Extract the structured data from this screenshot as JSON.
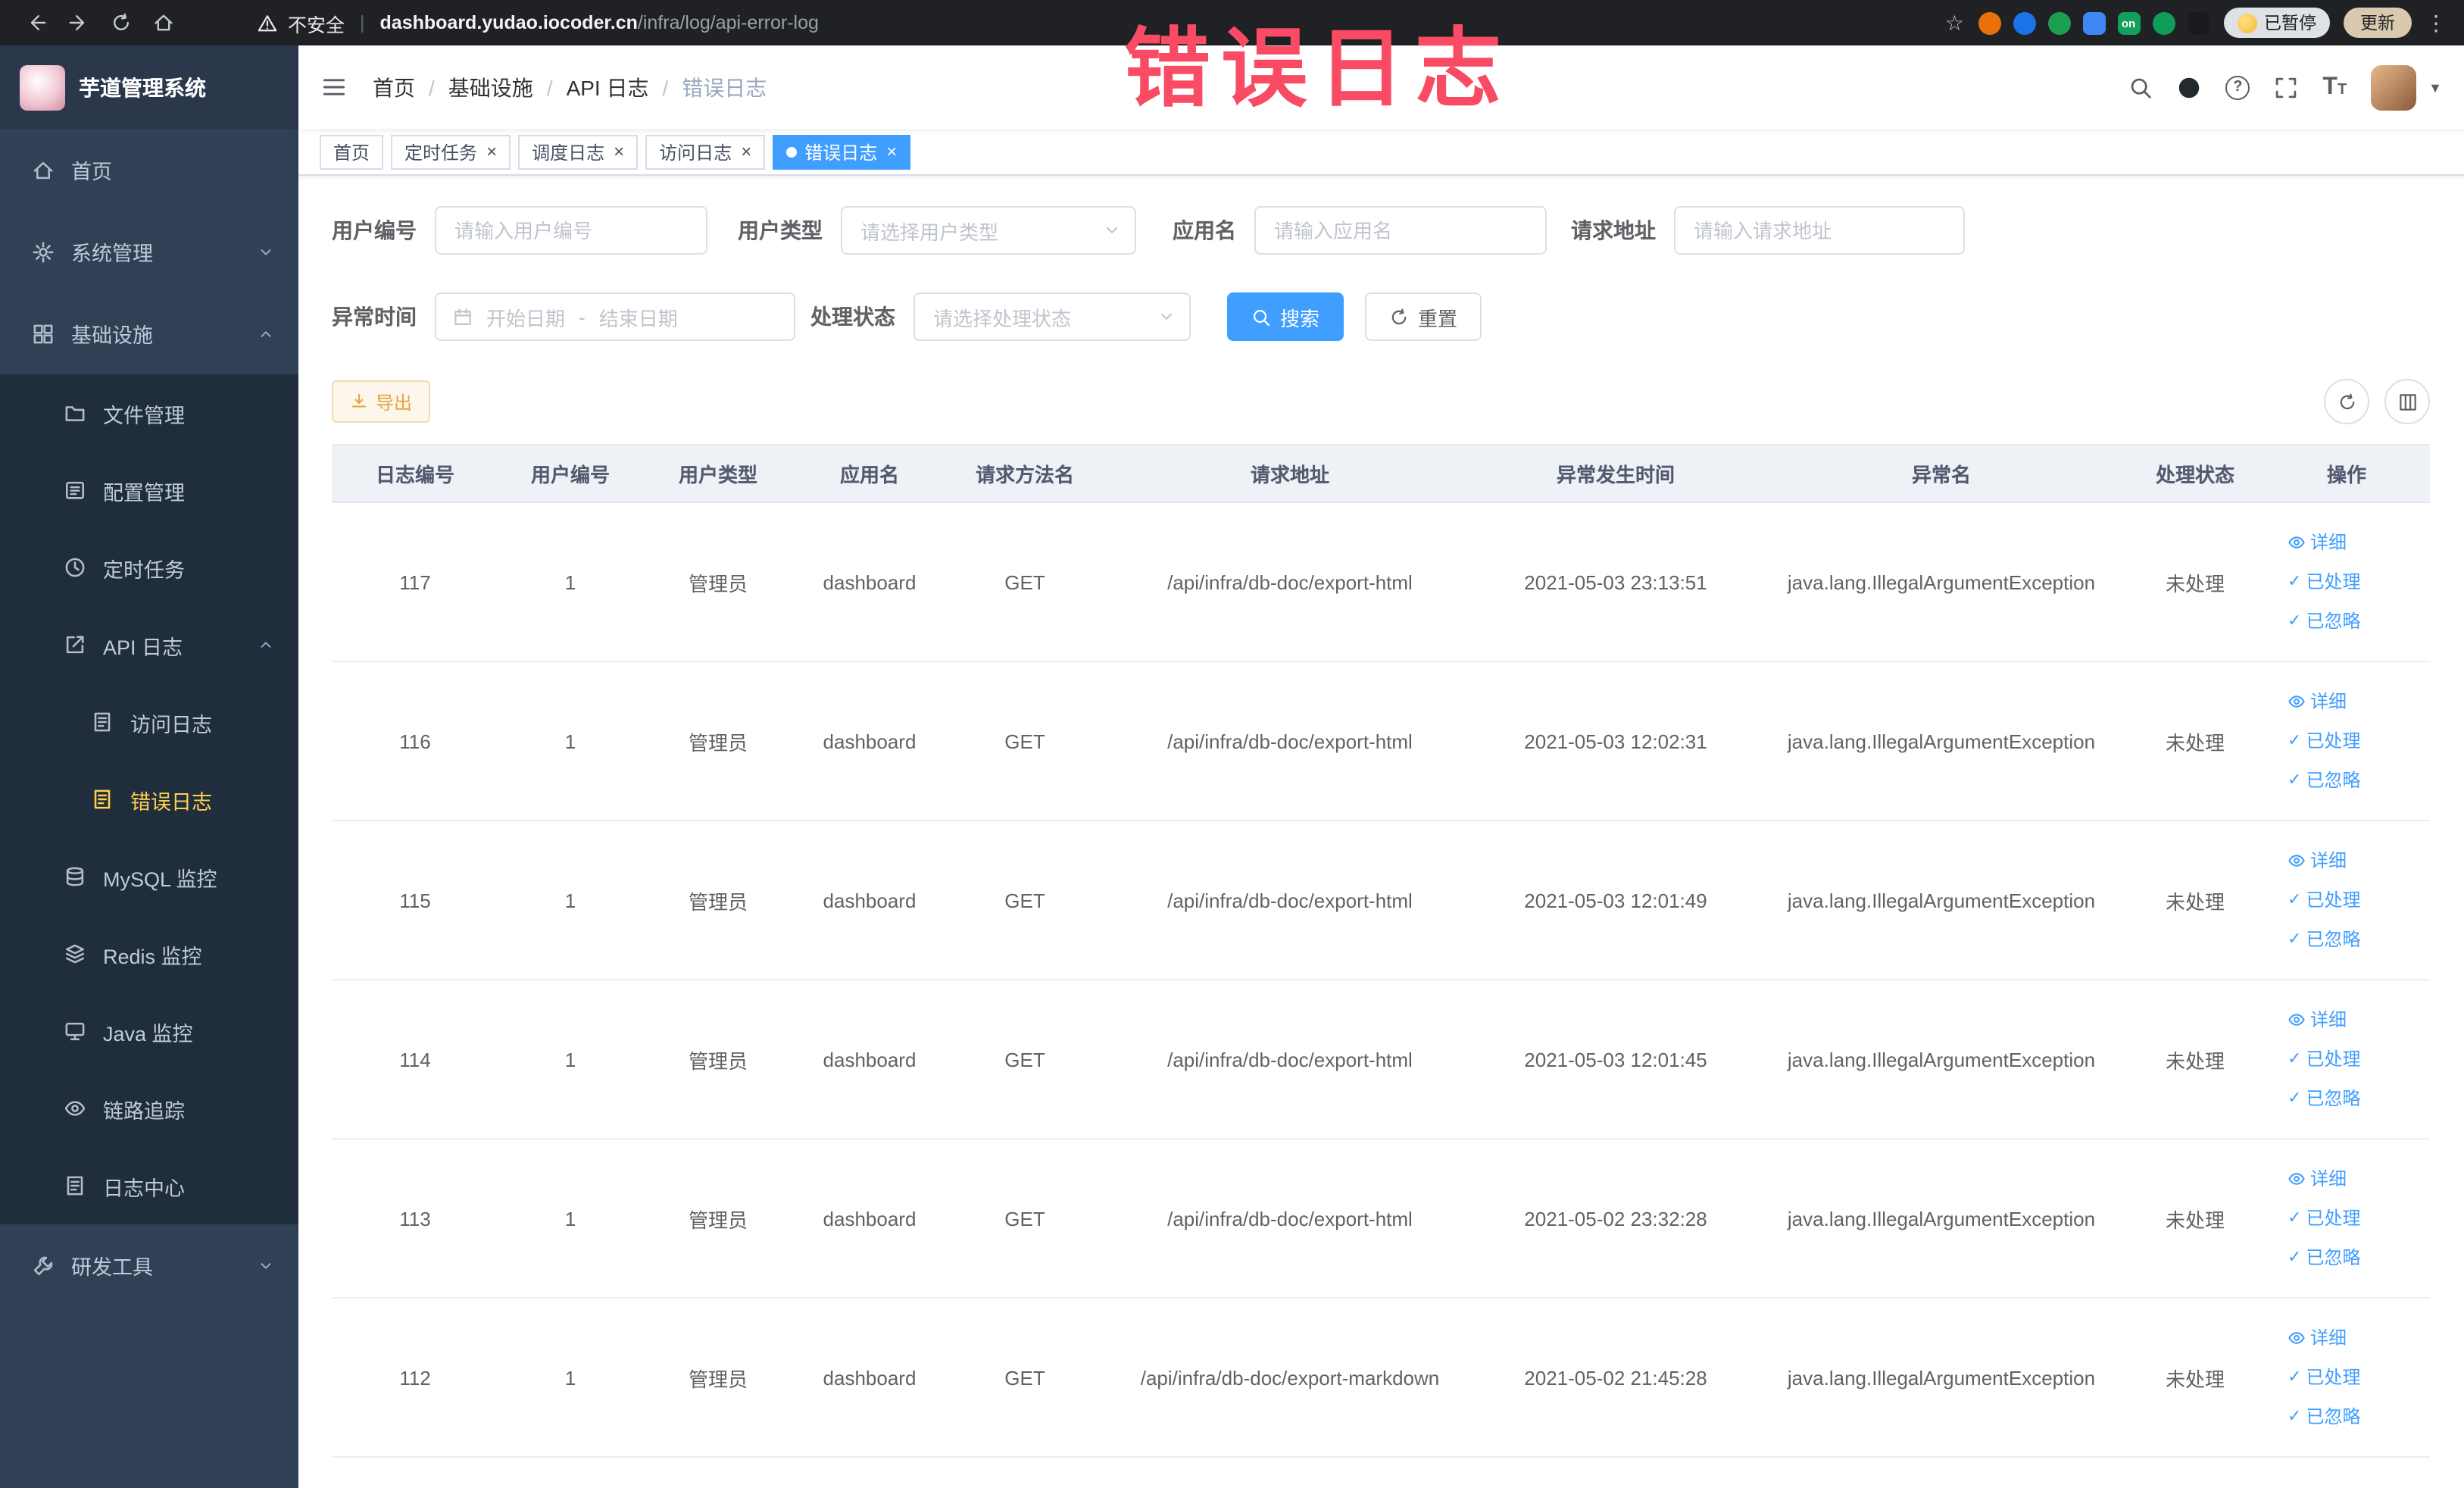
{
  "colors": {
    "primary": "#409eff",
    "menu_active": "#ffd04b",
    "annotation": "#f94b63",
    "warning": "#e6a23c"
  },
  "browser": {
    "security_label": "不安全",
    "url_separator": "|",
    "url_domain": "dashboard.yudao.iocoder.cn",
    "url_path": "/infra/log/api-error-log",
    "paused_label": "已暂停",
    "update_label": "更新",
    "extensions": [
      {
        "name": "extension-orange-icon",
        "color": "#e8710a",
        "shape": "circle"
      },
      {
        "name": "extension-drop-icon",
        "color": "#1a73e8",
        "shape": "circle"
      },
      {
        "name": "extension-green-circle-icon",
        "color": "#1e9e4f",
        "shape": "circle"
      },
      {
        "name": "extension-grid-icon",
        "color": "#4285f4",
        "shape": "square"
      },
      {
        "name": "extension-on-badge-icon",
        "color": "#12a05f",
        "shape": "square",
        "label": "on"
      },
      {
        "name": "extension-leaf-icon",
        "color": "#0f9d58",
        "shape": "circle"
      },
      {
        "name": "extension-paw-icon",
        "color": "#1b1b1f",
        "shape": "square"
      }
    ]
  },
  "sidebar": {
    "app_title": "芋道管理系统",
    "items": [
      {
        "label": "首页",
        "icon": "home-icon",
        "level": 1
      },
      {
        "label": "系统管理",
        "icon": "gear-icon",
        "level": 1,
        "chevron": "down"
      },
      {
        "label": "基础设施",
        "icon": "infrastructure-icon",
        "level": 1,
        "chevron": "up"
      },
      {
        "label": "文件管理",
        "icon": "file-manage-icon",
        "level": 2
      },
      {
        "label": "配置管理",
        "icon": "config-icon",
        "level": 2
      },
      {
        "label": "定时任务",
        "icon": "schedule-icon",
        "level": 2
      },
      {
        "label": "API 日志",
        "icon": "api-log-icon",
        "level": 2,
        "chevron": "up"
      },
      {
        "label": "访问日志",
        "icon": "access-log-icon",
        "level": 3
      },
      {
        "label": "错误日志",
        "icon": "error-log-icon",
        "level": 3,
        "active": true
      },
      {
        "label": "MySQL 监控",
        "icon": "mysql-icon",
        "level": 2
      },
      {
        "label": "Redis 监控",
        "icon": "redis-icon",
        "level": 2
      },
      {
        "label": "Java 监控",
        "icon": "java-icon",
        "level": 2
      },
      {
        "label": "链路追踪",
        "icon": "trace-icon",
        "level": 2
      },
      {
        "label": "日志中心",
        "icon": "log-center-icon",
        "level": 2
      },
      {
        "label": "研发工具",
        "icon": "tools-icon",
        "level": 1,
        "chevron": "down"
      }
    ]
  },
  "header": {
    "breadcrumb": [
      "首页",
      "基础设施",
      "API 日志",
      "错误日志"
    ],
    "breadcrumb_separator": "/"
  },
  "annotation": {
    "text": "错误日志"
  },
  "tags": [
    {
      "label": "首页",
      "closable": false,
      "active": false
    },
    {
      "label": "定时任务",
      "closable": true,
      "active": false
    },
    {
      "label": "调度日志",
      "closable": true,
      "active": false
    },
    {
      "label": "访问日志",
      "closable": true,
      "active": false
    },
    {
      "label": "错误日志",
      "closable": true,
      "active": true
    }
  ],
  "filters": {
    "user_id": {
      "label": "用户编号",
      "placeholder": "请输入用户编号"
    },
    "user_type": {
      "label": "用户类型",
      "placeholder": "请选择用户类型"
    },
    "app_name": {
      "label": "应用名",
      "placeholder": "请输入应用名"
    },
    "request_url": {
      "label": "请求地址",
      "placeholder": "请输入请求地址"
    },
    "exception_time": {
      "label": "异常时间",
      "start_placeholder": "开始日期",
      "separator": "-",
      "end_placeholder": "结束日期"
    },
    "process_status": {
      "label": "处理状态",
      "placeholder": "请选择处理状态"
    },
    "search_label": "搜索",
    "reset_label": "重置"
  },
  "toolbar": {
    "export_label": "导出"
  },
  "table": {
    "columns": [
      "日志编号",
      "用户编号",
      "用户类型",
      "应用名",
      "请求方法名",
      "请求地址",
      "异常发生时间",
      "异常名",
      "处理状态",
      "操作"
    ],
    "row_actions": [
      "详细",
      "已处理",
      "已忽略"
    ],
    "rows": [
      [
        "117",
        "1",
        "管理员",
        "dashboard",
        "GET",
        "/api/infra/db-doc/export-html",
        "2021-05-03 23:13:51",
        "java.lang.IllegalArgumentException",
        "未处理"
      ],
      [
        "116",
        "1",
        "管理员",
        "dashboard",
        "GET",
        "/api/infra/db-doc/export-html",
        "2021-05-03 12:02:31",
        "java.lang.IllegalArgumentException",
        "未处理"
      ],
      [
        "115",
        "1",
        "管理员",
        "dashboard",
        "GET",
        "/api/infra/db-doc/export-html",
        "2021-05-03 12:01:49",
        "java.lang.IllegalArgumentException",
        "未处理"
      ],
      [
        "114",
        "1",
        "管理员",
        "dashboard",
        "GET",
        "/api/infra/db-doc/export-html",
        "2021-05-03 12:01:45",
        "java.lang.IllegalArgumentException",
        "未处理"
      ],
      [
        "113",
        "1",
        "管理员",
        "dashboard",
        "GET",
        "/api/infra/db-doc/export-html",
        "2021-05-02 23:32:28",
        "java.lang.IllegalArgumentException",
        "未处理"
      ],
      [
        "112",
        "1",
        "管理员",
        "dashboard",
        "GET",
        "/api/infra/db-doc/export-markdown",
        "2021-05-02 21:45:28",
        "java.lang.IllegalArgumentException",
        "未处理"
      ]
    ]
  }
}
